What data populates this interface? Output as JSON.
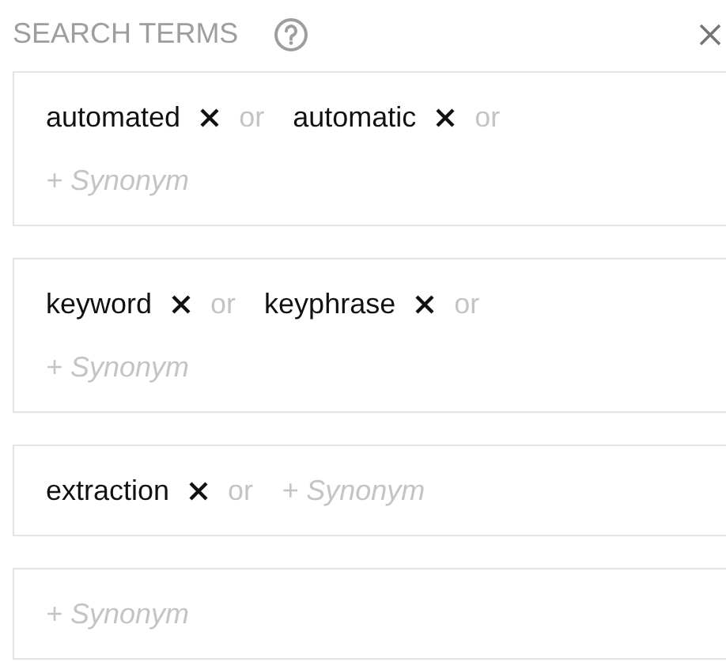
{
  "header": {
    "title": "SEARCH TERMS"
  },
  "groups": [
    {
      "terms": [
        {
          "text": "automated",
          "connector": "or"
        },
        {
          "text": "automatic",
          "connector": "or"
        }
      ],
      "placeholder": "+ Synonym"
    },
    {
      "terms": [
        {
          "text": "keyword",
          "connector": "or"
        },
        {
          "text": "keyphrase",
          "connector": "or"
        }
      ],
      "placeholder": "+ Synonym"
    },
    {
      "terms": [
        {
          "text": "extraction",
          "connector": "or"
        }
      ],
      "placeholder": "+ Synonym"
    },
    {
      "placeholder": "+ Synonym"
    }
  ]
}
